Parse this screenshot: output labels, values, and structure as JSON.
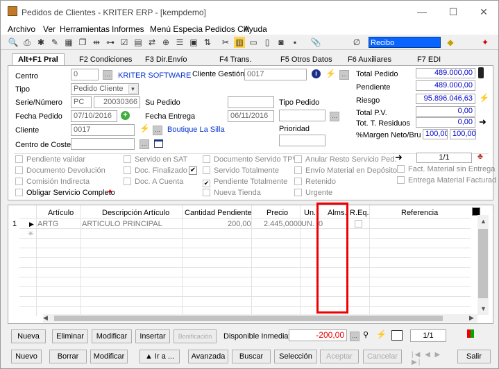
{
  "window": {
    "title": "Pedidos de Clientes - KRITER ERP - [kempdemo]",
    "minimize": "—",
    "maximize": "☐",
    "close": "✕"
  },
  "menubar": [
    "Archivo",
    "Ver",
    "Herramientas",
    "Informes",
    "Menú Especia Pedidos Clil",
    "Ayuda"
  ],
  "toolbar": {
    "recibo": "Recibo"
  },
  "tabs": [
    "Alt+F1 Pral",
    "F2 Condiciones",
    "F3 Dir.Envío",
    "F4 Trans.",
    "F5 Otros Datos",
    "F6 Auxiliares",
    "F7 EDI"
  ],
  "form": {
    "centro_label": "Centro",
    "centro": "0",
    "centro_name": "KRITER SOFTWARE",
    "cliente_gestion_label": "Cliente Gestión",
    "cliente_gestion": "0017",
    "tipo_label": "Tipo",
    "tipo": "Pedido Cliente",
    "serie_label": "Serie/Número",
    "serie": "PC",
    "numero": "20030366",
    "su_pedido_label": "Su Pedido",
    "tipo_pedido_label": "Tipo Pedido",
    "fecha_pedido_label": "Fecha Pedido",
    "fecha_pedido": "07/10/2016",
    "fecha_entrega_label": "Fecha Entrega",
    "fecha_entrega": "06/11/2016",
    "cliente_label": "Cliente",
    "cliente": "0017",
    "cliente_name": "Boutique La Silla",
    "prioridad_label": "Prioridad",
    "centro_coste_label": "Centro de Coste"
  },
  "totals": {
    "total_pedido_label": "Total Pedido",
    "total_pedido": "489.000,00",
    "pendiente_label": "Pendiente",
    "pendiente": "489.000,00",
    "riesgo_label": "Riesgo",
    "riesgo": "95.896.046,63",
    "total_pv_label": "Total P.V.",
    "total_pv": "0,00",
    "tot_residuos_label": "Tot. T. Residuos",
    "tot_residuos": "0,00",
    "margen_label": "%Margen Neto/Bru",
    "margen_neto": "100,00",
    "margen_bruto": "100,00",
    "page": "1/1"
  },
  "checks": {
    "col1": [
      "Pendiente validar",
      "Documento Devolución",
      "Comisión Indirecta",
      "Obligar Servicio Completo"
    ],
    "col2": [
      "Servido en SAT",
      "Doc. Finalizado",
      "Doc. A Cuenta"
    ],
    "col3": [
      "Documento Servido TPV",
      "Servido Totalmente",
      "Pendiente Totalmente",
      "Nueva Tienda"
    ],
    "col4": [
      "Anular Resto Servicio Ped.",
      "Envío Material en Depósito",
      "Retenido",
      "Urgente"
    ],
    "col5": [
      "Fact. Material sin Entrega",
      "Entrega Material Facturad"
    ]
  },
  "grid": {
    "headers": [
      "Artículo",
      "Descripción Artículo",
      "Cantidad Pendiente",
      "Precio",
      "Un.",
      "Alms.",
      "R.Eq.",
      "Referencia"
    ],
    "row": {
      "num": "1",
      "articulo": "ARTG",
      "descripcion": "ARTICULO PRINCIPAL",
      "cantidad": "200,00",
      "precio": "2.445,0000",
      "un": "UN.",
      "alms": "0"
    }
  },
  "line_buttons": {
    "nueva": "Nueva",
    "eliminar": "Eliminar",
    "modificar": "Modificar",
    "insertar": "Insertar",
    "bonificacion": "Bonificación",
    "disponible_label": "Disponible Inmediato",
    "disponible": "-200,00",
    "page": "1/1"
  },
  "bottom_buttons": {
    "nuevo": "Nuevo",
    "borrar": "Borrar",
    "modificar": "Modificar",
    "ira": "▲ Ir a ...",
    "avanzada": "Avanzada",
    "buscar": "Buscar",
    "seleccion": "Selección",
    "aceptar": "Aceptar",
    "cancelar": "Cancelar",
    "salir": "Salir"
  }
}
